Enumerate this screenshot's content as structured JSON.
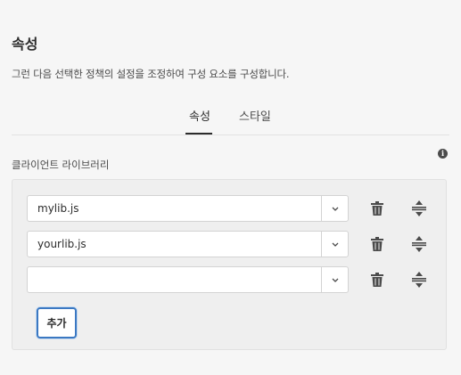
{
  "header": {
    "title": "속성",
    "description": "그런 다음 선택한 정책의 설정을 조정하여 구성 요소를 구성합니다."
  },
  "tabs": [
    {
      "label": "속성",
      "active": true
    },
    {
      "label": "스타일",
      "active": false
    }
  ],
  "section": {
    "label": "클라이언트 라이브러리",
    "info_icon": "info-icon"
  },
  "libraries": [
    {
      "value": "mylib.js"
    },
    {
      "value": "yourlib.js"
    },
    {
      "value": ""
    }
  ],
  "add_button_label": "추가",
  "colors": {
    "accent": "#3b78c2",
    "background": "#f6f6f6",
    "panel": "#efefef"
  }
}
